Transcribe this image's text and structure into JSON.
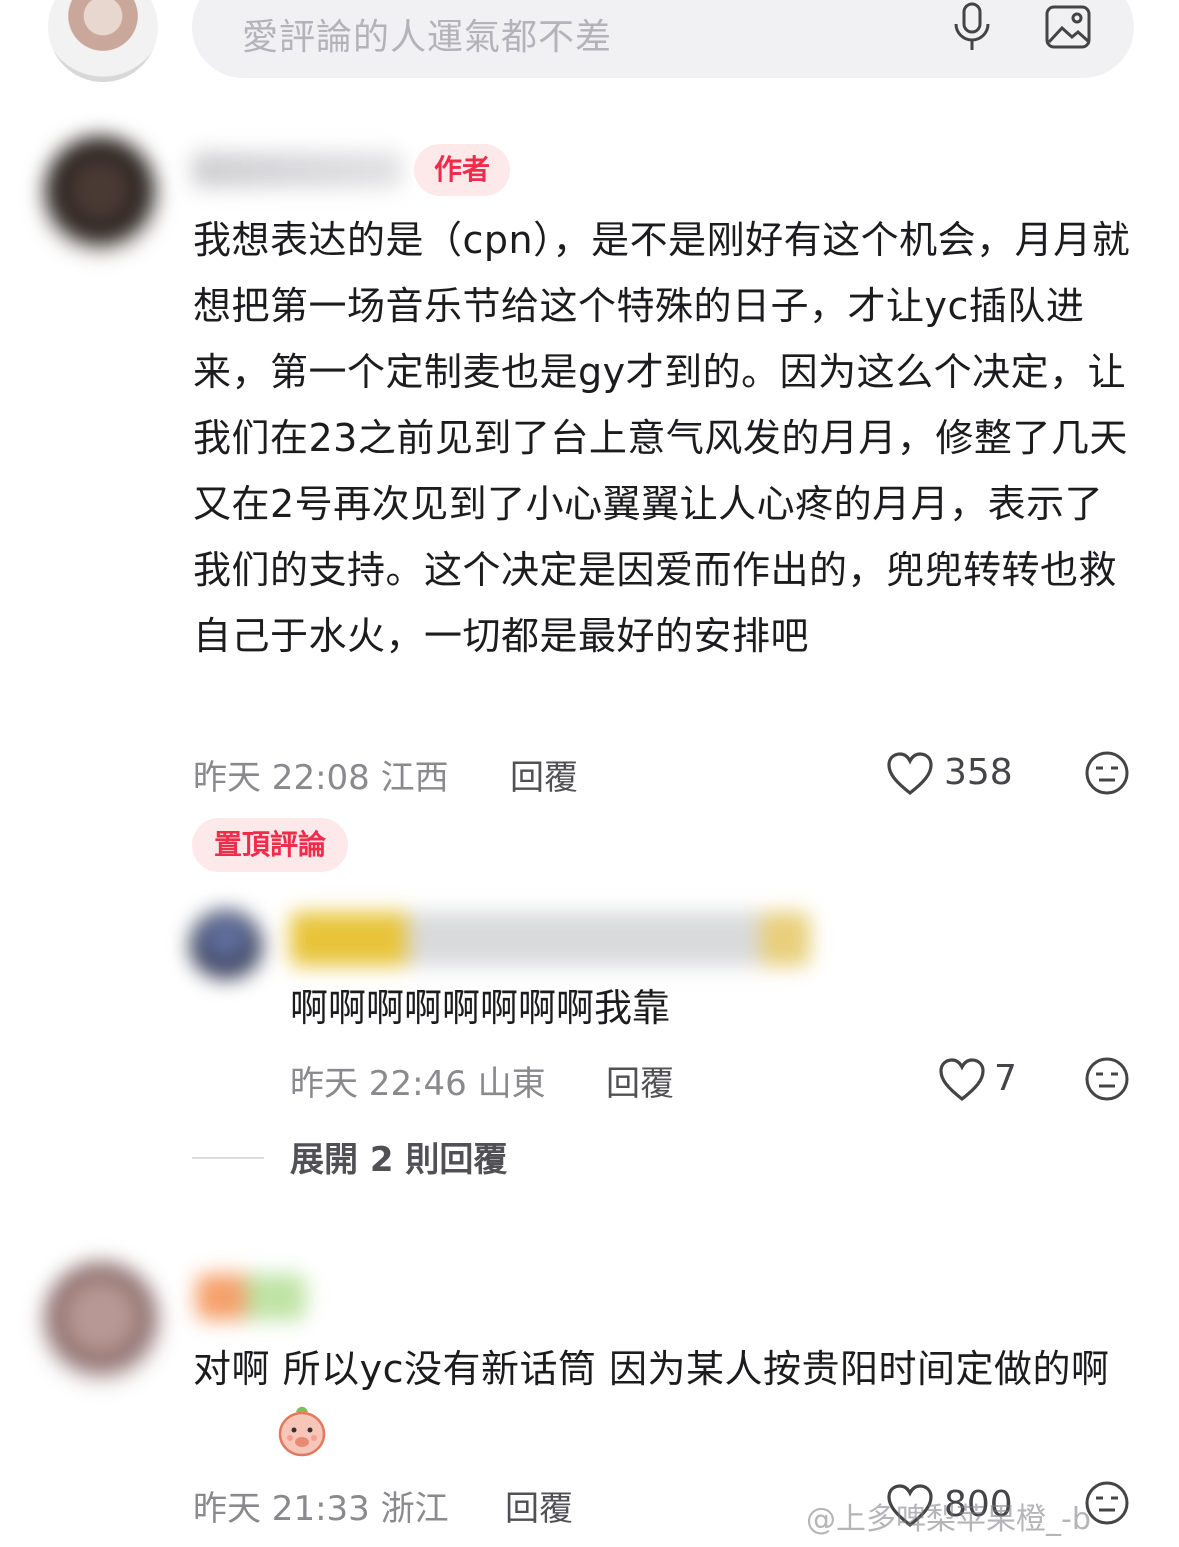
{
  "input": {
    "placeholder": "愛評論的人運氣都不差"
  },
  "comments": [
    {
      "badge": "作者",
      "text": "我想表达的是（cpn），是不是刚好有这个机会，月月就想把第一场音乐节给这个特殊的日子，才让yc插队进来，第一个定制麦也是gy才到的。因为这么个决定，让我们在23之前见到了台上意气风发的月月，修整了几天又在2号再次见到了小心翼翼让人心疼的月月，表示了我们的支持。这个决定是因爱而作出的，兜兜转转也救自己于水火，一切都是最好的安排吧",
      "meta": "昨天 22:08 江西",
      "reply_label": "回覆",
      "likes": "358",
      "pinned_label": "置頂評論",
      "replies": [
        {
          "text": "啊啊啊啊啊啊啊啊我靠",
          "meta": "昨天 22:46 山東",
          "reply_label": "回覆",
          "likes": "7"
        }
      ],
      "expand_label": "展開 2 則回覆"
    },
    {
      "text": "对啊 所以yc没有新话筒 因为某人按贵阳时间定做的啊",
      "meta": "昨天 21:33 浙江",
      "reply_label": "回覆",
      "likes": "800"
    }
  ],
  "watermark": "@上多啤梨苹果橙_-b",
  "colors": {
    "accent": "#ee2d4b",
    "badge_bg": "#fde8ea",
    "meta_text": "#8a8a8e"
  },
  "icons": [
    "mic-icon",
    "image-icon",
    "heart-icon",
    "emoji-icon",
    "sticker-icon"
  ]
}
